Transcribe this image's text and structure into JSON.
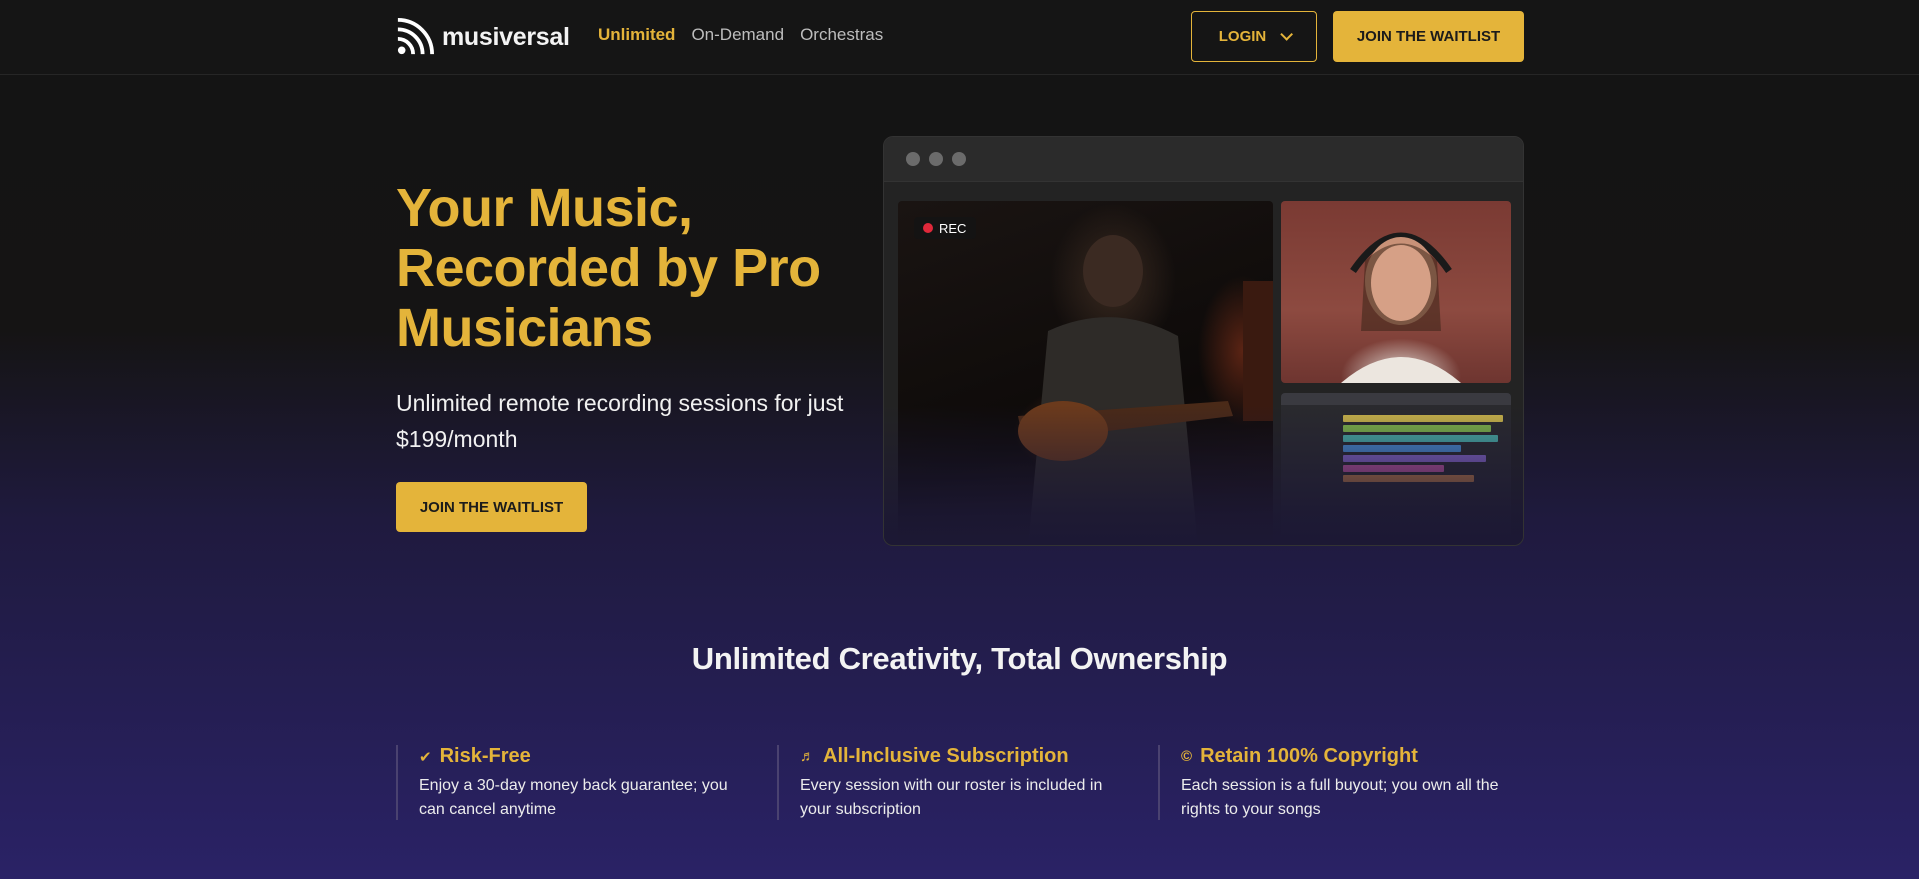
{
  "brand": {
    "name": "musiversal"
  },
  "nav": {
    "links": [
      {
        "label": "Unlimited",
        "active": true
      },
      {
        "label": "On-Demand",
        "active": false
      },
      {
        "label": "Orchestras",
        "active": false
      }
    ],
    "login_label": "LOGIN",
    "cta_label": "JOIN THE WAITLIST"
  },
  "hero": {
    "title": "Your Music, Recorded by Pro Musicians",
    "subtitle": "Unlimited remote recording sessions for just $199/month",
    "cta_label": "JOIN THE WAITLIST",
    "rec_label": "REC"
  },
  "section": {
    "title": "Unlimited Creativity, Total Ownership",
    "features": [
      {
        "icon": "badge-check-icon",
        "glyph": "✔",
        "title": "Risk-Free",
        "text": "Enjoy a 30-day money back guarantee; you can cancel anytime"
      },
      {
        "icon": "music-note-icon",
        "glyph": "♬",
        "title": "All-Inclusive Subscription",
        "text": "Every session with our roster is included in your subscription"
      },
      {
        "icon": "copyright-icon",
        "glyph": "©",
        "title": "Retain 100% Copyright",
        "text": "Each session is a full buyout; you own all the rights to your songs"
      }
    ]
  },
  "colors": {
    "accent": "#e4b43a",
    "background_top": "#141414",
    "background_bottom": "#2a2266",
    "rec_dot": "#e0283a"
  }
}
